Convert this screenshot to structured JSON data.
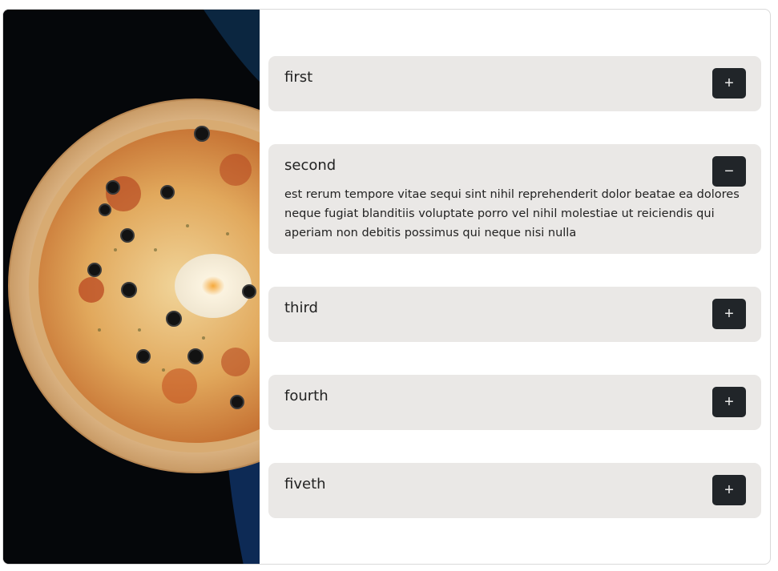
{
  "accordion": {
    "items": [
      {
        "title": "first",
        "toggle": "+",
        "expanded": false
      },
      {
        "title": "second",
        "toggle": "−",
        "expanded": true,
        "body": "est rerum tempore vitae sequi sint nihil reprehenderit dolor beatae ea dolores neque fugiat blanditiis voluptate porro vel nihil molestiae ut reiciendis qui aperiam non debitis possimus qui neque nisi nulla"
      },
      {
        "title": "third",
        "toggle": "+",
        "expanded": false
      },
      {
        "title": "fourth",
        "toggle": "+",
        "expanded": false
      },
      {
        "title": "fiveth",
        "toggle": "+",
        "expanded": false
      }
    ]
  },
  "colors": {
    "item_bg": "#eae8e6",
    "button_bg": "#212529",
    "photo_bg": "#05070a"
  }
}
